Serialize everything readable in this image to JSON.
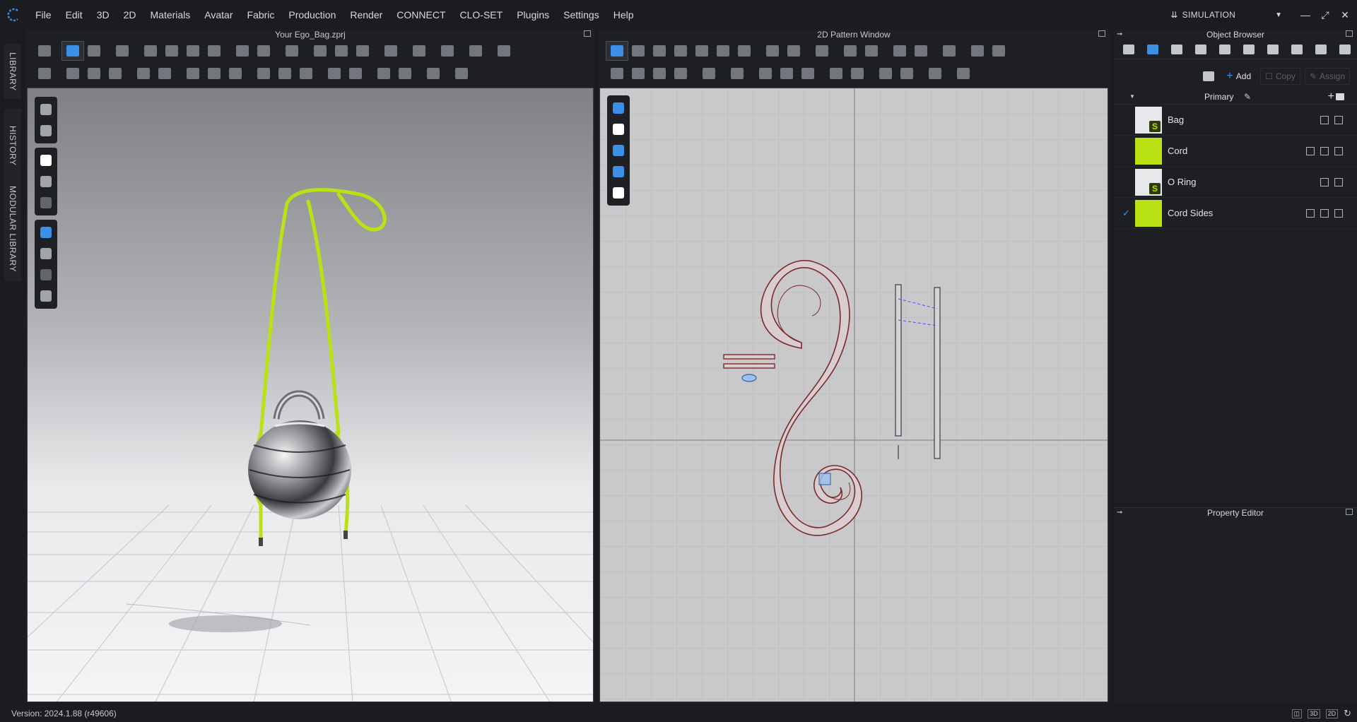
{
  "menu": {
    "items": [
      "File",
      "Edit",
      "3D",
      "2D",
      "Materials",
      "Avatar",
      "Fabric",
      "Production",
      "Render",
      "CONNECT",
      "CLO-SET",
      "Plugins",
      "Settings",
      "Help"
    ],
    "mode_label": "SIMULATION"
  },
  "left_tabs": {
    "library": "LIBRARY",
    "history": "HISTORY",
    "modular": "MODULAR LIBRARY"
  },
  "panel3d": {
    "title": "Your Ego_Bag.zprj"
  },
  "panel2d": {
    "title": "2D Pattern Window"
  },
  "object_browser": {
    "title": "Object Browser",
    "add_label": "Add",
    "copy_label": "Copy",
    "assign_label": "Assign",
    "group_name": "Primary",
    "items": [
      {
        "label": "Bag",
        "swatch": "texture",
        "checked": false
      },
      {
        "label": "Cord",
        "swatch": "#b9e215",
        "checked": false
      },
      {
        "label": "O Ring",
        "swatch": "texture",
        "checked": false
      },
      {
        "label": "Cord Sides",
        "swatch": "#b9e215",
        "checked": true
      }
    ]
  },
  "property_editor": {
    "title": "Property Editor"
  },
  "status": {
    "version": "Version: 2024.1.88 (r49606)"
  },
  "colors": {
    "accent": "#3b8fe6",
    "cord": "#b9e215",
    "pattern_outline": "#7a2a2a"
  }
}
